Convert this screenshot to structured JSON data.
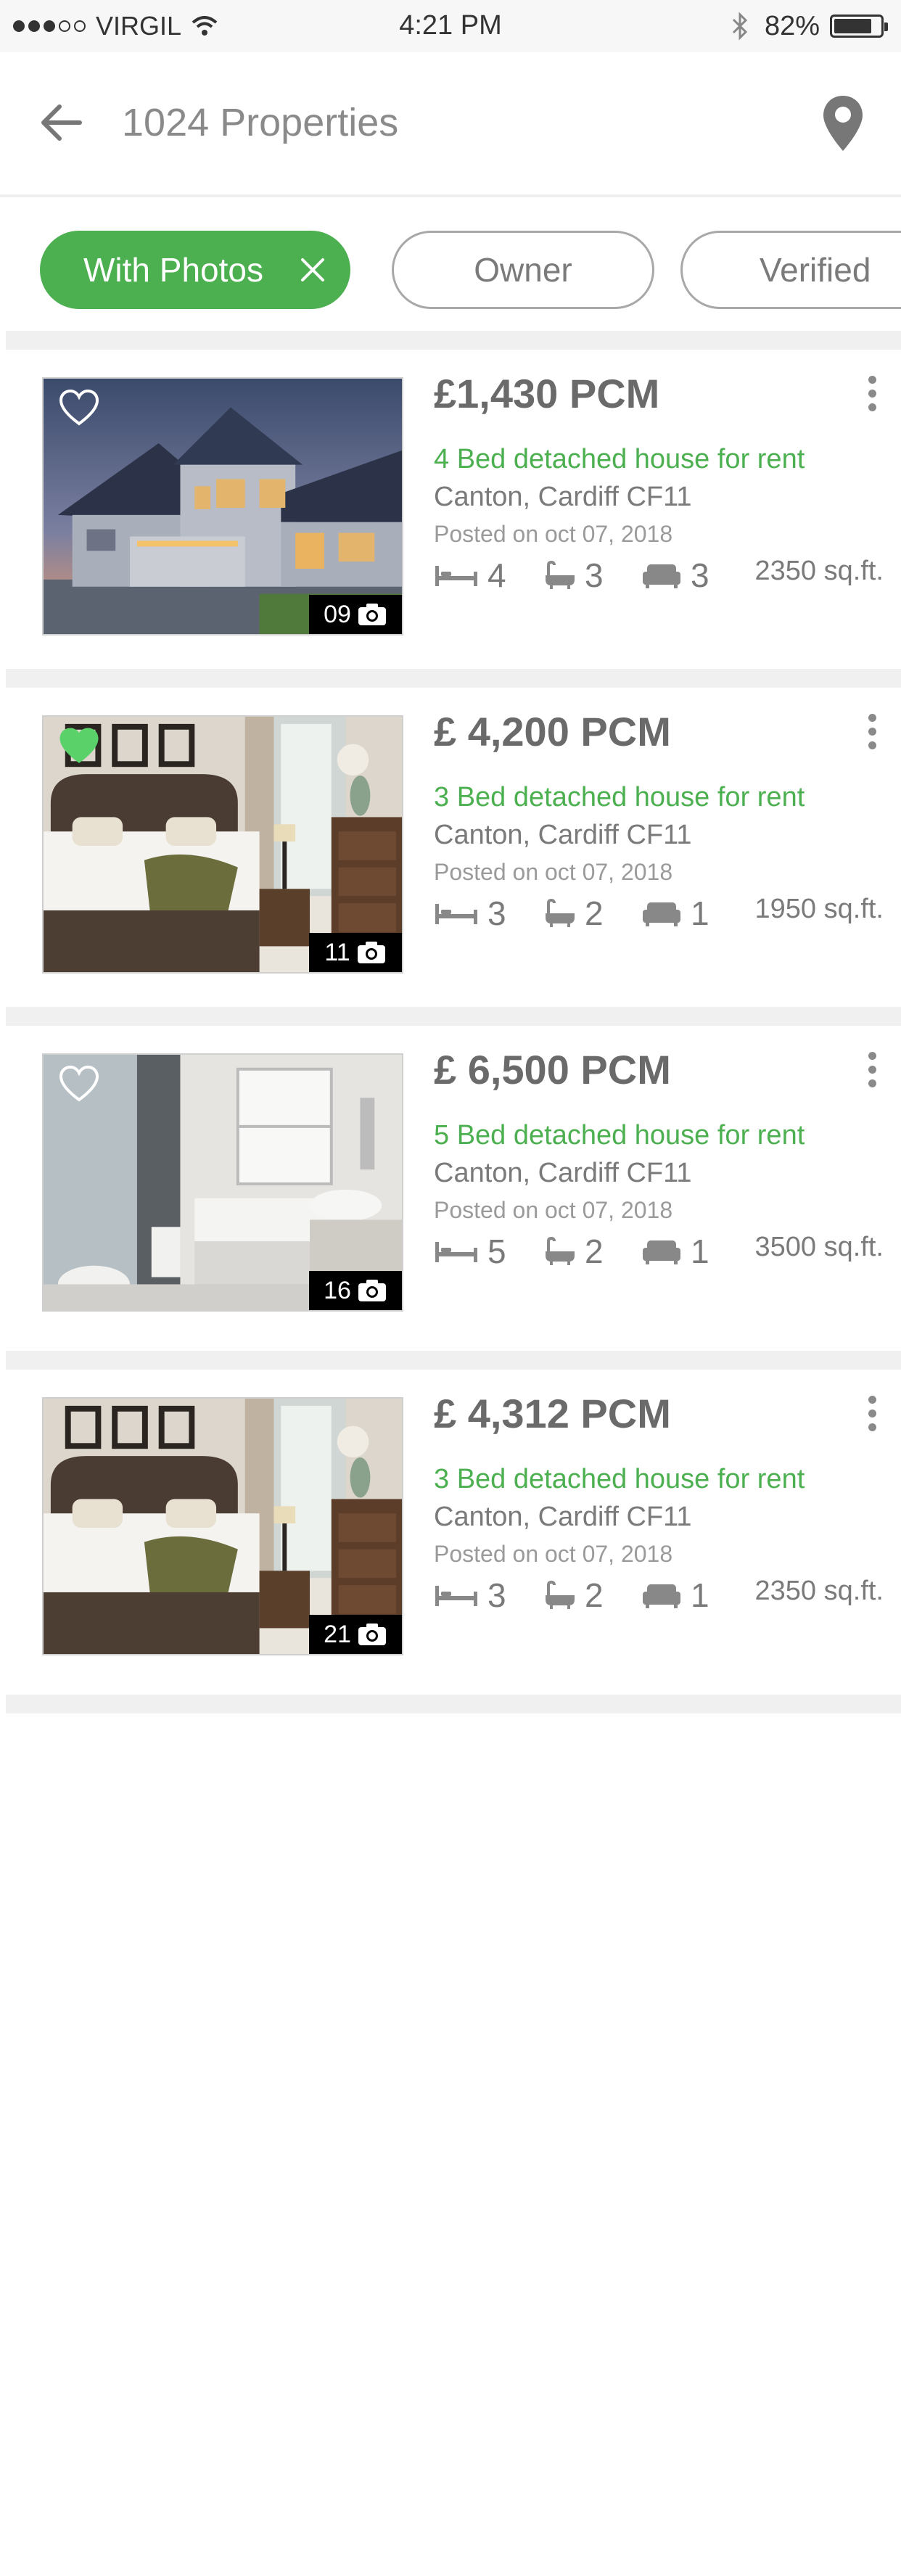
{
  "status_bar": {
    "carrier": "VIRGIL",
    "time": "4:21 PM",
    "battery": "82%",
    "battery_level": 0.82
  },
  "header": {
    "title": "1024 Properties",
    "back_icon": "back-arrow-icon",
    "map_icon": "map-pin-icon"
  },
  "filters": [
    {
      "label": "With Photos",
      "active": true
    },
    {
      "label": "Owner",
      "active": false
    },
    {
      "label": "Verified",
      "active": false
    }
  ],
  "colors": {
    "accent": "#4cb050",
    "text_gray": "#6a6a6a",
    "divider": "#f0f0f0"
  },
  "listings": [
    {
      "price": "£1,430 PCM",
      "title": "4 Bed detached house for rent",
      "location": "Canton, Cardiff CF11",
      "posted": "Posted on oct 07, 2018",
      "beds": "4",
      "baths": "3",
      "living": "3",
      "area": "2350 sq.ft.",
      "photos": "09",
      "favorite": false,
      "image": "house-exterior"
    },
    {
      "price": "£ 4,200 PCM",
      "title": "3 Bed detached house for rent",
      "location": "Canton, Cardiff CF11",
      "posted": "Posted on oct 07, 2018",
      "beds": "3",
      "baths": "2",
      "living": "1",
      "area": "1950 sq.ft.",
      "photos": "11",
      "favorite": true,
      "image": "bedroom"
    },
    {
      "price": "£ 6,500 PCM",
      "title": "5 Bed detached house for rent",
      "location": "Canton, Cardiff CF11",
      "posted": "Posted on oct 07, 2018",
      "beds": "5",
      "baths": "2",
      "living": "1",
      "area": "3500 sq.ft.",
      "photos": "16",
      "favorite": false,
      "image": "bathroom"
    },
    {
      "price": "£ 4,312 PCM",
      "title": "3 Bed detached house for rent",
      "location": "Canton, Cardiff CF11",
      "posted": "Posted on oct 07, 2018",
      "beds": "3",
      "baths": "2",
      "living": "1",
      "area": "2350 sq.ft.",
      "photos": "21",
      "favorite": false,
      "image": "bedroom"
    }
  ]
}
